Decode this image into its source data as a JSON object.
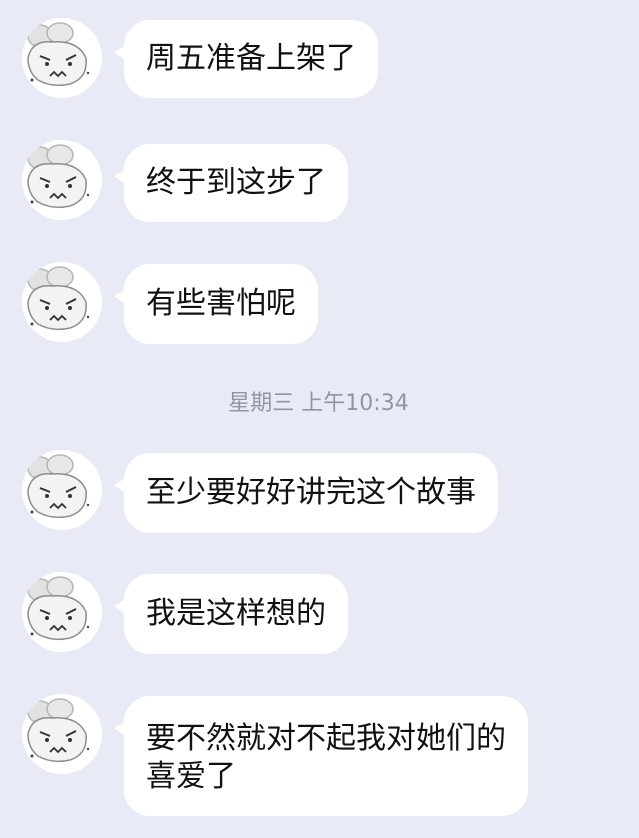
{
  "messages": [
    {
      "text": "周五准备上架了"
    },
    {
      "text": "终于到这步了"
    },
    {
      "text": "有些害怕呢"
    },
    {
      "text": "至少要好好讲完这个故事"
    },
    {
      "text": "我是这样想的"
    },
    {
      "text": "要不然就对不起我对她们的\n喜爱了"
    }
  ],
  "timestamp": "星期三 上午10:34",
  "avatar": {
    "icon": "grumpy-bear-avatar-icon"
  },
  "colors": {
    "background": "#e8ebf5",
    "bubble": "#ffffff",
    "timestamp_text": "#8f95a3"
  }
}
